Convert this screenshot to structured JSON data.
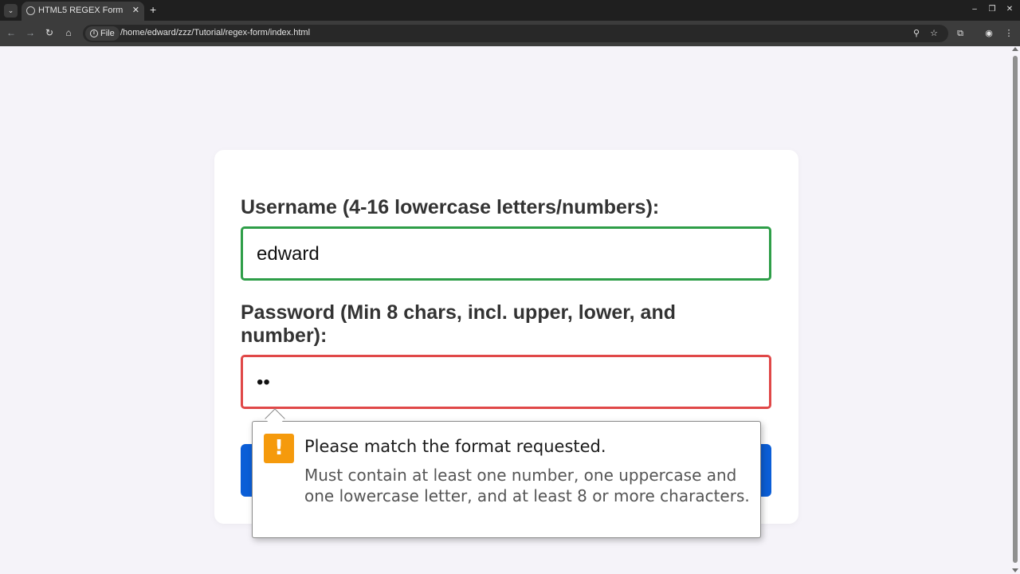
{
  "browser": {
    "tab_title": "HTML5 REGEX Form",
    "new_tab_label": "+",
    "site_chip_label": "File",
    "url": "/home/edward/zzz/Tutorial/regex-form/index.html"
  },
  "form": {
    "username_label": "Username (4-16 lowercase letters/numbers):",
    "username_value": "edward",
    "password_label": "Password (Min 8 chars, incl. upper, lower, and number):",
    "password_mask": "••"
  },
  "validation": {
    "title": "Please match the format requested.",
    "message": "Must contain at least one number, one uppercase and one lowercase letter, and at least 8 or more characters."
  },
  "colors": {
    "valid_border": "#2e9e48",
    "invalid_border": "#e04848",
    "submit_button": "#0b5ed7",
    "warning_icon": "#f59a0c",
    "page_background": "#f5f3f9"
  },
  "icons": [
    "tab-search-icon",
    "page-favicon-icon",
    "tab-close-icon",
    "minimize-icon",
    "restore-icon",
    "close-window-icon",
    "back-icon",
    "forward-icon",
    "reload-icon",
    "home-icon",
    "info-icon",
    "zoom-icon",
    "bookmark-star-icon",
    "extensions-icon",
    "profile-icon",
    "menu-icon",
    "warning-icon"
  ]
}
